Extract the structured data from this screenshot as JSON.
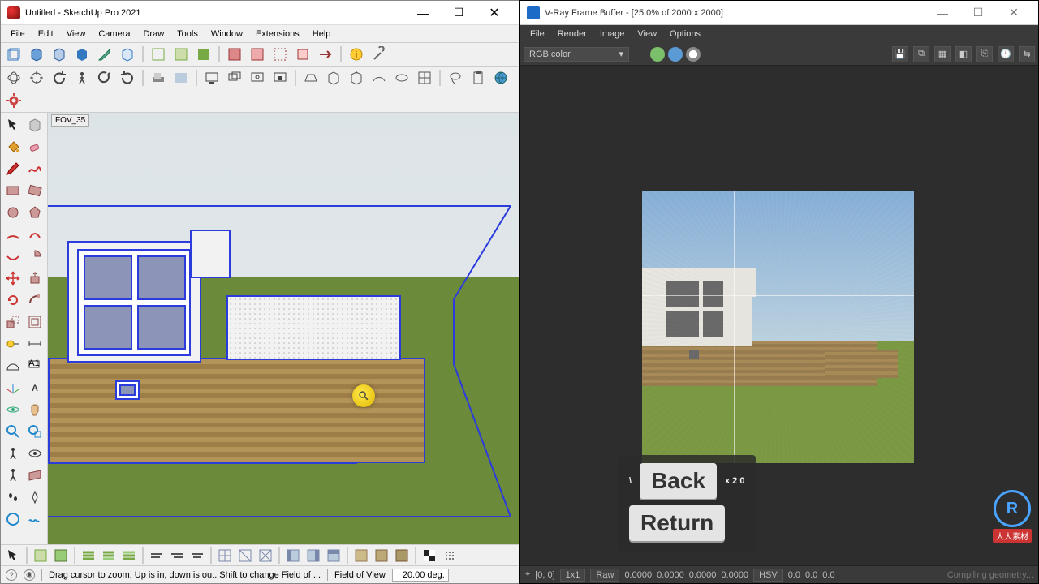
{
  "sketchup": {
    "title": "Untitled - SketchUp Pro 2021",
    "menus": [
      "File",
      "Edit",
      "View",
      "Camera",
      "Draw",
      "Tools",
      "Window",
      "Extensions",
      "Help"
    ],
    "fov_label": "FOV_35",
    "status_hint": "Drag cursor to zoom.  Up is in, down is out. Shift to change Field of ...",
    "status_field_label": "Field of View",
    "status_field_value": "20.00 deg.",
    "window_controls": {
      "min": "—",
      "max": "☐",
      "close": "✕"
    }
  },
  "vray": {
    "title": "V-Ray Frame Buffer - [25.0% of 2000 x 2000]",
    "menus": [
      "File",
      "Render",
      "Image",
      "View",
      "Options"
    ],
    "channel_dropdown": "RGB color",
    "channels": {
      "red": "#e06666",
      "green": "#7bbf6a",
      "blue": "#5b9bd5",
      "alpha": "#cccccc"
    },
    "status": {
      "coord": "[0, 0]",
      "grid": "1x1",
      "raw": "Raw",
      "vals": [
        "0.0000",
        "0.0000",
        "0.0000",
        "0.0000"
      ],
      "mode": "HSV",
      "mode_vals": [
        "0.0",
        "0.0",
        "0.0"
      ],
      "right_text": "Compiling geometry..."
    },
    "window_controls": {
      "min": "—",
      "max": "☐",
      "close": "✕"
    }
  },
  "key_overlay": {
    "row1_prefix": "\\",
    "row1_key": "Back",
    "row1_suffix": "x 2  0",
    "row2_key": "Return"
  },
  "branding": {
    "initials": "R",
    "text": "人人素材"
  }
}
